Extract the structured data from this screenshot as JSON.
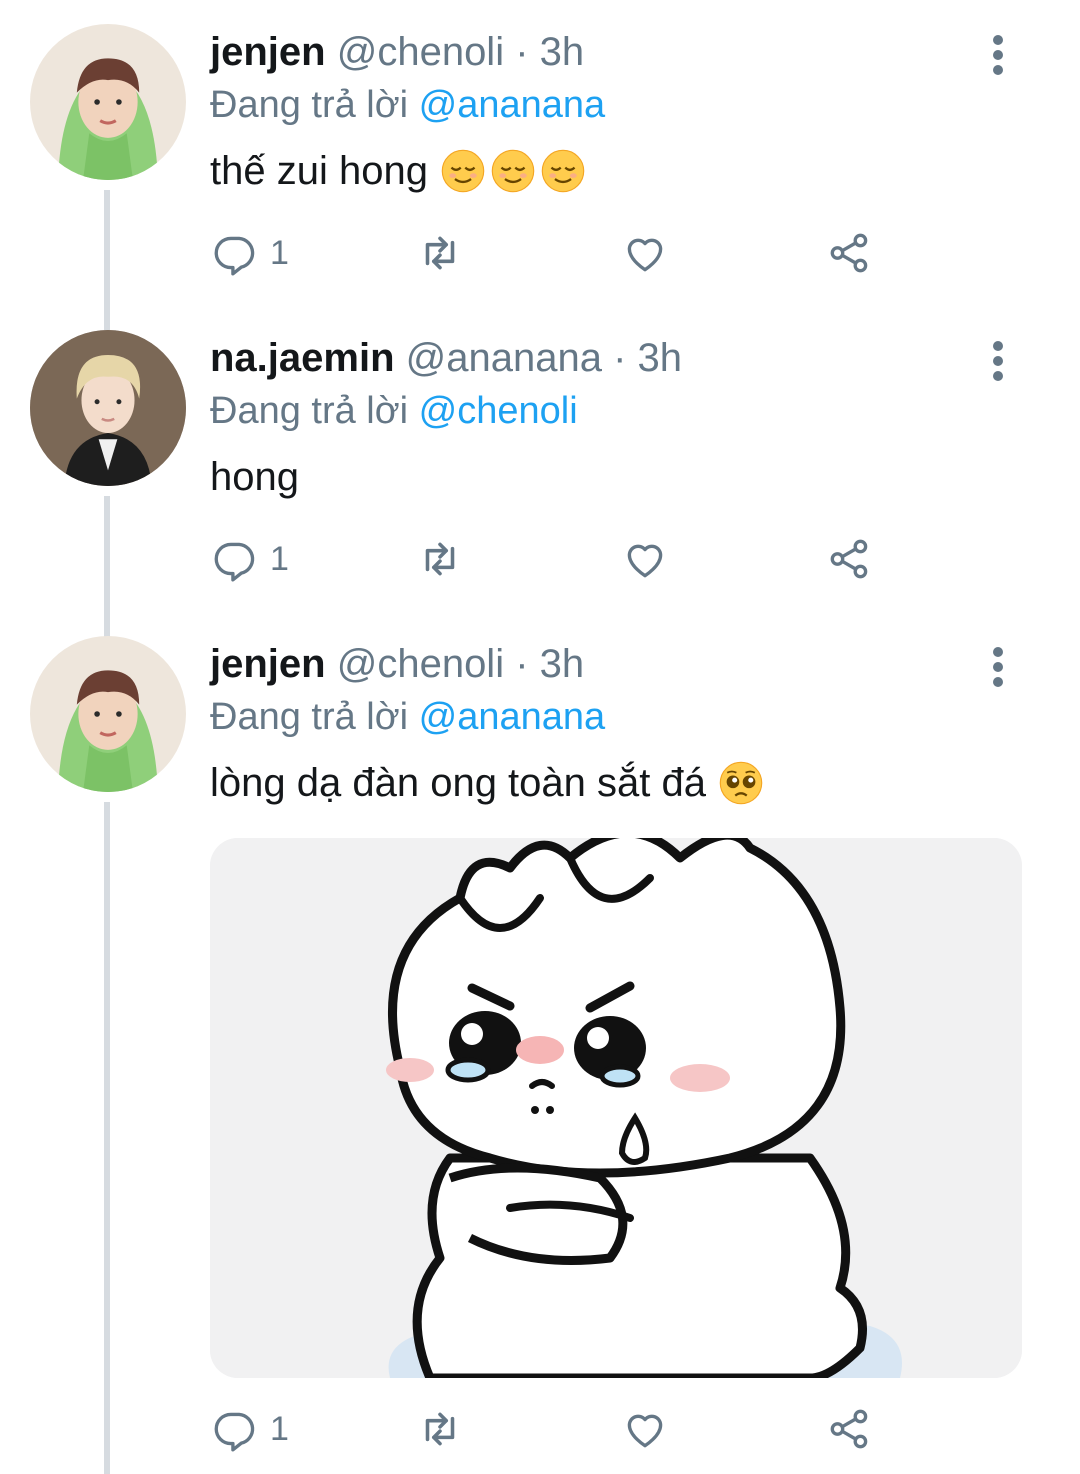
{
  "tweets": [
    {
      "name": "jenjen",
      "handle": "@chenoli",
      "dot": "·",
      "time": "3h",
      "reply_prefix": "Đang trả lời",
      "reply_to": "@ananana",
      "text": "thế zui hong",
      "emojis": [
        "relieved-face",
        "relieved-face",
        "relieved-face"
      ],
      "actions": {
        "reply_count": "1",
        "retweet_count": "",
        "like_count": ""
      }
    },
    {
      "name": "na.jaemin",
      "handle": "@ananana",
      "dot": "·",
      "time": "3h",
      "reply_prefix": "Đang trả lời",
      "reply_to": "@chenoli",
      "text": "hong",
      "emojis": [],
      "actions": {
        "reply_count": "1",
        "retweet_count": "",
        "like_count": ""
      }
    },
    {
      "name": "jenjen",
      "handle": "@chenoli",
      "dot": "·",
      "time": "3h",
      "reply_prefix": "Đang trả lời",
      "reply_to": "@ananana",
      "text": "lòng dạ đàn ong toàn sắt đá",
      "emojis": [
        "pleading-face"
      ],
      "media": "crying-cartoon-sticker",
      "actions": {
        "reply_count": "1",
        "retweet_count": "",
        "like_count": ""
      }
    }
  ],
  "colors": {
    "text": "#14171a",
    "secondary": "#657786",
    "link": "#1da1f2",
    "thread_line": "#d6dbe0"
  },
  "icons": [
    "reply-icon",
    "retweet-icon",
    "like-icon",
    "share-icon",
    "more-options-icon"
  ]
}
